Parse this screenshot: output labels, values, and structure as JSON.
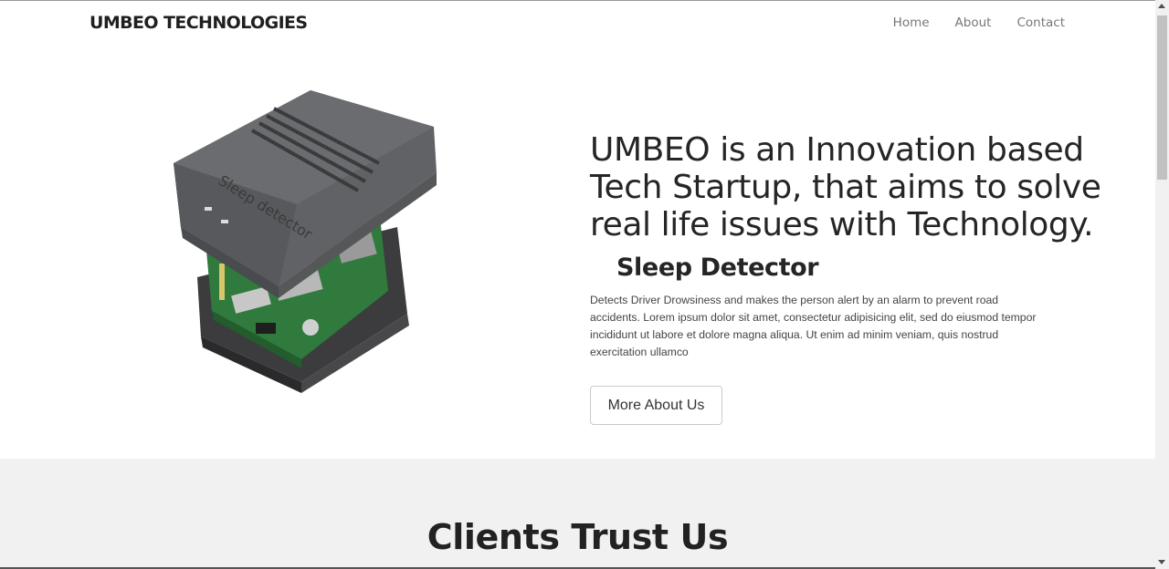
{
  "navbar": {
    "brand": "UMBEO TECHNOLOGIES",
    "links": [
      "Home",
      "About",
      "Contact"
    ]
  },
  "hero": {
    "image_icon": "sleep-detector-device",
    "image_label": "Sleep detector",
    "headline": "UMBEO is an Innovation based Tech Startup, that aims to solve real life issues with Technology.",
    "product_title": "Sleep Detector",
    "description": "Detects Driver Drowsiness and makes the person alert by an alarm to prevent road accidents. Lorem ipsum dolor sit amet, consectetur adipisicing elit, sed do eiusmod tempor incididunt ut labore et dolore magna aliqua. Ut enim ad minim veniam, quis nostrud exercitation ullamco",
    "button_label": "More About Us"
  },
  "clients": {
    "title": "Clients Trust Us"
  },
  "colors": {
    "text_dark": "#252525",
    "nav_link": "#777777",
    "section_bg": "#f1f1f1",
    "device_body": "#5e5f62",
    "pcb_green": "#2f7a3c"
  }
}
